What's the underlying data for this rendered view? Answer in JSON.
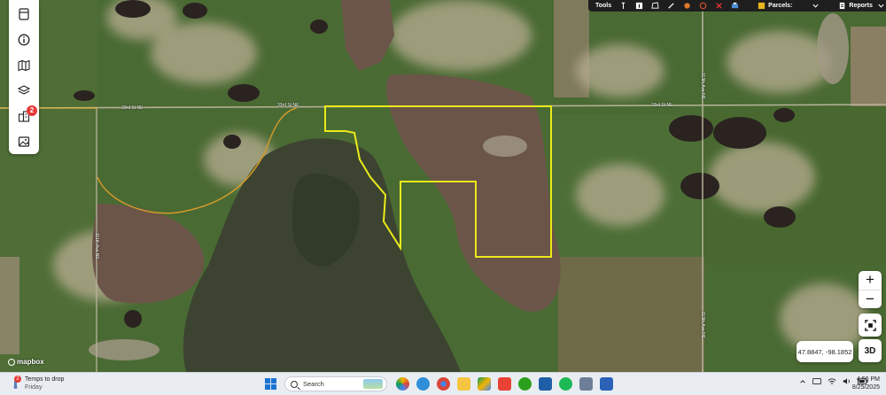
{
  "toolbar": {
    "tools_label": "Tools",
    "parcels_label": "Parcels:",
    "reports_label": "Reports"
  },
  "left_toolbar": {
    "tools": [
      {
        "icon": "layers-panel-icon"
      },
      {
        "icon": "info-icon"
      },
      {
        "icon": "map-icon"
      },
      {
        "icon": "layers-icon"
      },
      {
        "icon": "buildings-icon",
        "badge": "2"
      },
      {
        "icon": "image-icon"
      }
    ]
  },
  "map": {
    "roads": {
      "road_a": "33rd St NE",
      "road_b": "33rd St NE",
      "road_c": "33rd St NE",
      "road_d": "111th Ave NE",
      "road_e": "113th Ave NE",
      "road_f": "113th Ave NE"
    },
    "attribution": "mapbox",
    "coordinates": "47.8847, -98.1852",
    "zoom_in": "+",
    "zoom_out": "−",
    "view_3d": "3D"
  },
  "taskbar": {
    "weather_badge": "2",
    "weather_title": "Temps to drop",
    "weather_sub": "Friday",
    "search_placeholder": "Search",
    "time": "4:56 PM",
    "date": "8/25/2025"
  }
}
